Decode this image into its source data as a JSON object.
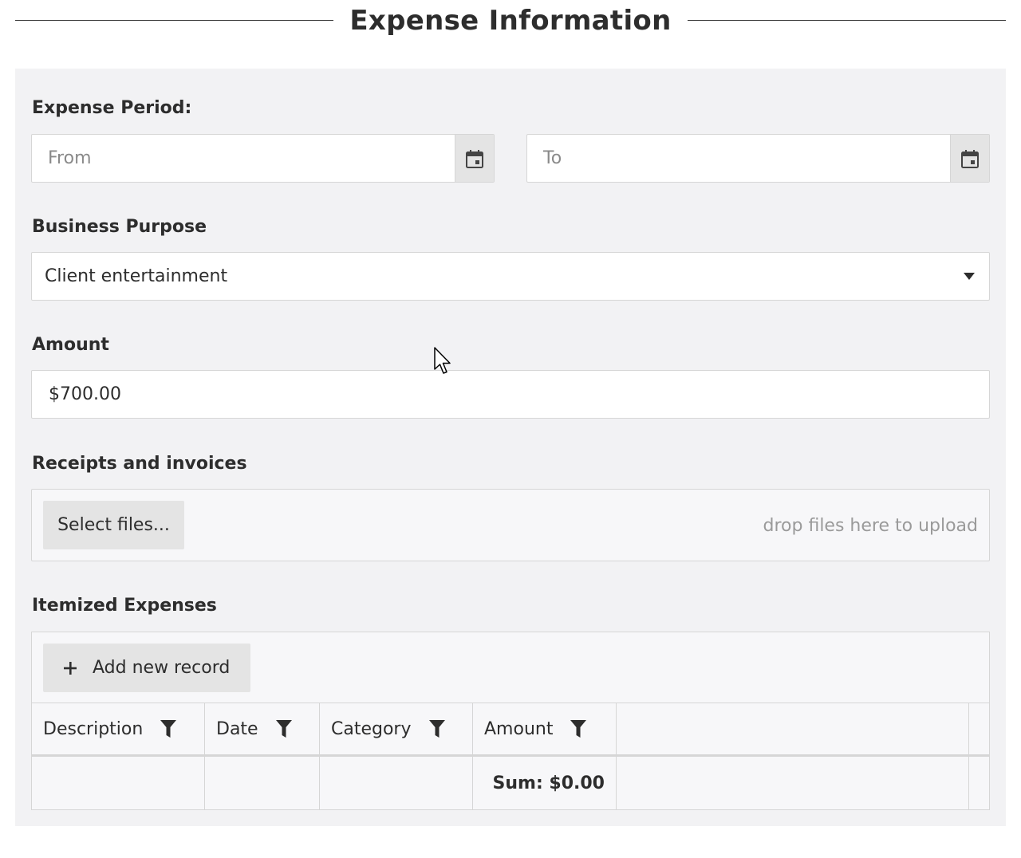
{
  "legend": {
    "title": "Expense Information"
  },
  "period": {
    "label": "Expense Period:",
    "from_placeholder": "From",
    "to_placeholder": "To"
  },
  "purpose": {
    "label": "Business Purpose",
    "value": "Client entertainment"
  },
  "amount": {
    "label": "Amount",
    "value": "$700.00"
  },
  "receipts": {
    "label": "Receipts and invoices",
    "select_button": "Select files...",
    "drop_hint": "drop files here to upload"
  },
  "itemized": {
    "label": "Itemized Expenses",
    "add_button": "Add new record",
    "columns": [
      "Description",
      "Date",
      "Category",
      "Amount"
    ],
    "sum_label": "Sum: $0.00"
  },
  "icons": {
    "calendar": "calendar-icon",
    "dropdown": "caret-down-icon",
    "filter": "filter-icon",
    "add": "plus-icon",
    "cursor": "mouse-pointer-icon"
  },
  "colors": {
    "panel": "#f2f2f4",
    "button": "#e4e4e4",
    "border": "#d6d6d6",
    "text": "#2d2d2d"
  }
}
